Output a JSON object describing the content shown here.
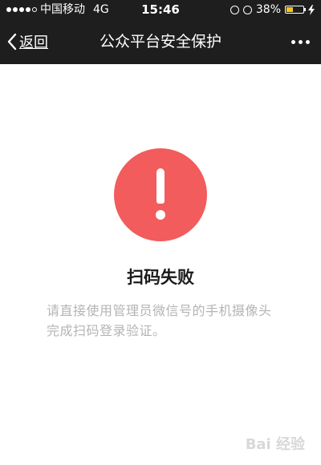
{
  "status_bar": {
    "carrier": "中国移动",
    "network": "4G",
    "time": "15:46",
    "battery_percent": "38%",
    "battery_level": 0.38
  },
  "nav": {
    "back_label": "返回",
    "title": "公众平台安全保护"
  },
  "content": {
    "icon": "exclamation-icon",
    "title": "扫码失败",
    "description": "请直接使用管理员微信号的手机摄像头完成扫码登录验证。"
  },
  "watermark": "Bai 经验",
  "colors": {
    "bar_bg": "#1e1e1e",
    "error_red": "#f25c5c",
    "battery_yellow": "#f5c518",
    "desc_gray": "#b4b4b4"
  }
}
